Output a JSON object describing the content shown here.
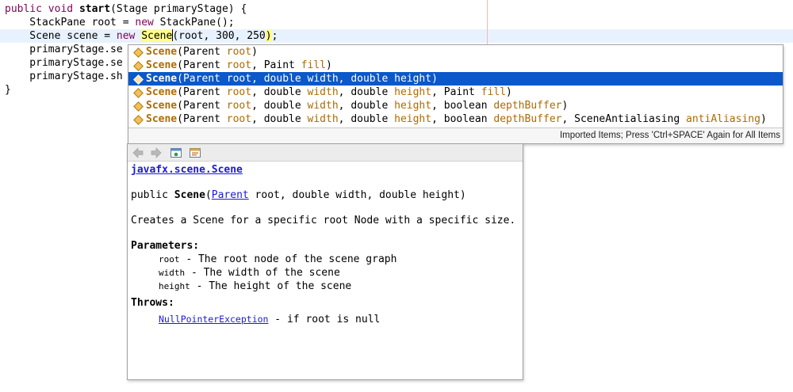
{
  "editor": {
    "lines": [
      {
        "parts": [
          {
            "t": "public",
            "k": "kw"
          },
          {
            "t": " "
          },
          {
            "t": "void",
            "k": "kw"
          },
          {
            "t": " "
          },
          {
            "t": "start",
            "k": "b"
          },
          {
            "t": "(Stage primaryStage) {"
          }
        ]
      },
      {
        "parts": [
          {
            "t": "    StackPane root = "
          },
          {
            "t": "new",
            "k": "kw"
          },
          {
            "t": " StackPane();"
          }
        ]
      },
      {
        "parts": [
          {
            "t": "    Scene scene = "
          },
          {
            "t": "new",
            "k": "kw"
          },
          {
            "t": " "
          },
          {
            "t": "Scene",
            "k": "hl"
          },
          {
            "t": "CARET"
          },
          {
            "t": "(root, 300, 250",
            "k": "paren"
          },
          {
            "t": ")",
            "k": "hl"
          },
          {
            "t": ";"
          }
        ]
      },
      {
        "parts": [
          {
            "t": "    primaryStage.se"
          }
        ]
      },
      {
        "parts": [
          {
            "t": "    primaryStage.se"
          }
        ]
      },
      {
        "parts": [
          {
            "t": "    primaryStage.sh"
          }
        ]
      },
      {
        "parts": [
          {
            "t": "}"
          }
        ]
      }
    ]
  },
  "completion": {
    "items": [
      {
        "name": "Scene",
        "params": [
          {
            "type": "Parent",
            "pname": "root"
          }
        ],
        "selected": false
      },
      {
        "name": "Scene",
        "params": [
          {
            "type": "Parent",
            "pname": "root"
          },
          {
            "type": "Paint",
            "pname": "fill"
          }
        ],
        "selected": false
      },
      {
        "name": "Scene",
        "params": [
          {
            "type": "Parent",
            "pname": "root"
          },
          {
            "type": "double",
            "pname": "width"
          },
          {
            "type": "double",
            "pname": "height"
          }
        ],
        "selected": true
      },
      {
        "name": "Scene",
        "params": [
          {
            "type": "Parent",
            "pname": "root"
          },
          {
            "type": "double",
            "pname": "width"
          },
          {
            "type": "double",
            "pname": "height"
          },
          {
            "type": "Paint",
            "pname": "fill"
          }
        ],
        "selected": false
      },
      {
        "name": "Scene",
        "params": [
          {
            "type": "Parent",
            "pname": "root"
          },
          {
            "type": "double",
            "pname": "width"
          },
          {
            "type": "double",
            "pname": "height"
          },
          {
            "type": "boolean",
            "pname": "depthBuffer"
          }
        ],
        "selected": false
      },
      {
        "name": "Scene",
        "params": [
          {
            "type": "Parent",
            "pname": "root"
          },
          {
            "type": "double",
            "pname": "width"
          },
          {
            "type": "double",
            "pname": "height"
          },
          {
            "type": "boolean",
            "pname": "depthBuffer"
          },
          {
            "type": "SceneAntialiasing",
            "pname": "antiAliasing"
          }
        ],
        "selected": false
      }
    ],
    "status": "Imported Items; Press 'Ctrl+SPACE' Again for All Items"
  },
  "javadoc": {
    "class_link": "javafx.scene.Scene",
    "sig_prefix": "public ",
    "sig_name": "Scene",
    "sig_open": "(",
    "sig_param_type_link": "Parent",
    "sig_rest": " root, double width, double height)",
    "description": "Creates a Scene for a specific root Node with a specific size.",
    "parameters_heading": "Parameters:",
    "parameters": [
      {
        "name": "root",
        "desc": " - The root node of the scene graph"
      },
      {
        "name": "width",
        "desc": " - The width of the scene"
      },
      {
        "name": "height",
        "desc": " - The height of the scene"
      }
    ],
    "throws_heading": "Throws:",
    "throws": [
      {
        "exception": "NullPointerException",
        "desc": " - if root is null"
      }
    ],
    "toolbar_icons": [
      "back-arrow-icon",
      "forward-arrow-icon",
      "open-in-browser-icon",
      "show-source-icon"
    ]
  },
  "colors": {
    "keyword": "#7f0055",
    "selection": "#0a58c9",
    "match_highlight": "#fffc8a",
    "param_name": "#b06a00",
    "link": "#1a1adb"
  }
}
